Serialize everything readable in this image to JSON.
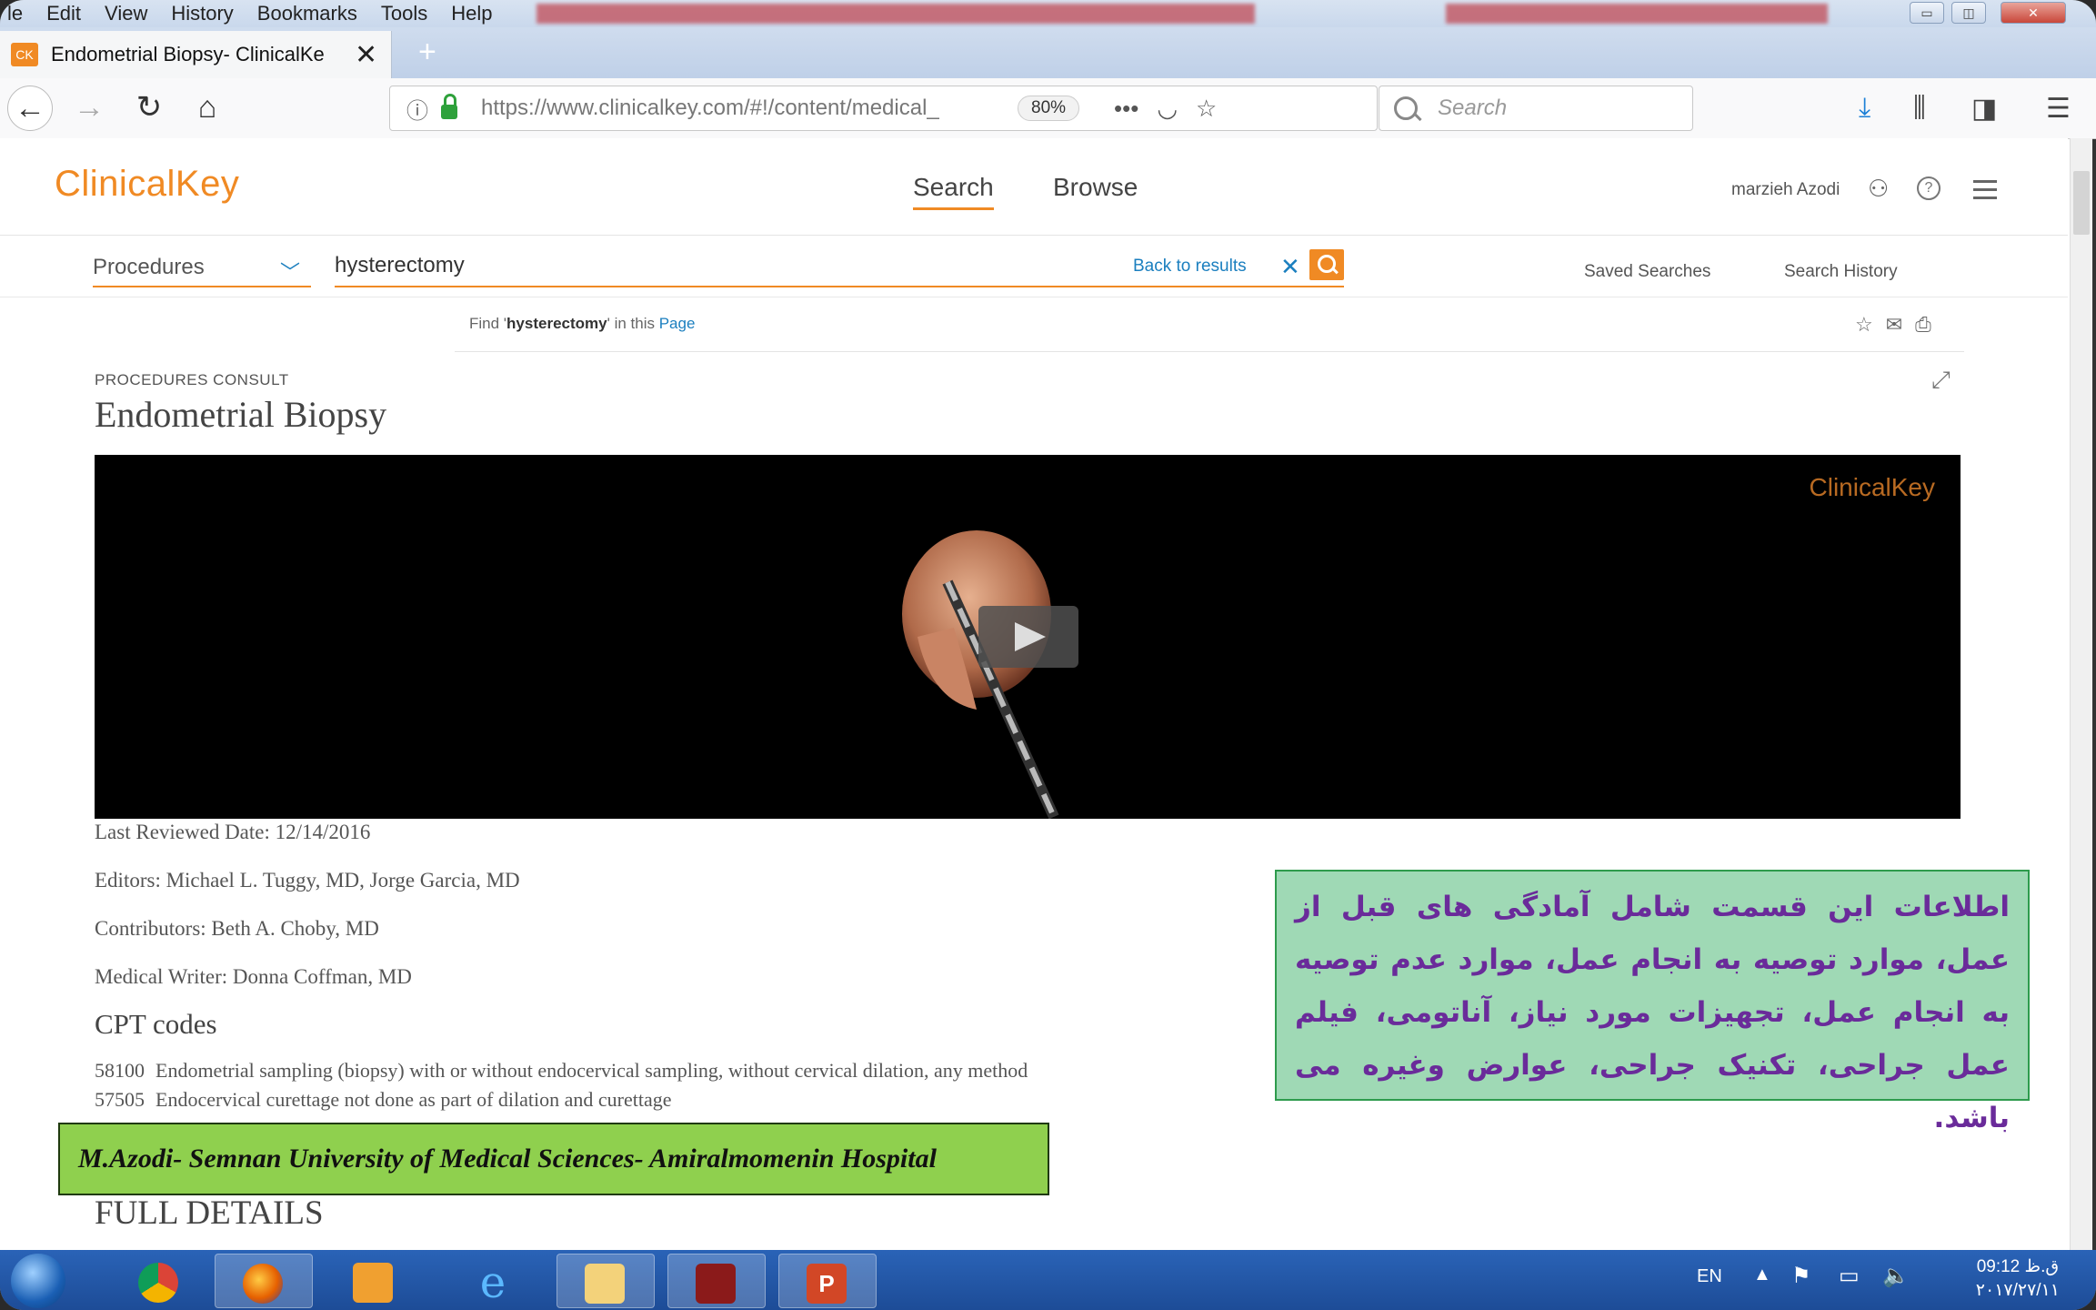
{
  "browser": {
    "menu": [
      "le",
      "Edit",
      "View",
      "History",
      "Bookmarks",
      "Tools",
      "Help"
    ],
    "tab": {
      "favicon": "CK",
      "title": "Endometrial Biopsy- ClinicalKe",
      "close": "✕"
    },
    "new_tab": "+",
    "url": "https://www.clinicalkey.com/#!/content/medical_",
    "zoom": "80%",
    "search_placeholder": "Search",
    "icons": [
      "back-icon",
      "forward-icon",
      "reload-icon",
      "home-icon",
      "info-icon",
      "lock-icon",
      "more-icon",
      "pocket-icon",
      "star-icon",
      "download-icon",
      "library-icon",
      "sidebar-icon",
      "menu-icon"
    ]
  },
  "clinicalkey": {
    "logo": "ClinicalKey",
    "nav": {
      "search": "Search",
      "browse": "Browse"
    },
    "user": "marzieh Azodi",
    "search": {
      "category": "Procedures",
      "query": "hysterectomy",
      "back_to_results": "Back to results",
      "saved_searches": "Saved Searches",
      "search_history": "Search History"
    },
    "find": {
      "prefix": "Find '",
      "term": "hysterectomy",
      "middle": "' in this ",
      "link": "Page"
    },
    "article": {
      "eyebrow": "PROCEDURES CONSULT",
      "title": "Endometrial Biopsy",
      "video_logo": "ClinicalKey",
      "reviewed": "Last Reviewed Date: 12/14/2016",
      "editors": "Editors: Michael L. Tuggy, MD, Jorge Garcia, MD",
      "contributors": "Contributors: Beth A. Choby, MD",
      "writer": "Medical Writer: Donna Coffman, MD",
      "cpt_heading": "CPT codes",
      "cpt": [
        {
          "code": "58100",
          "desc": "Endometrial sampling (biopsy) with or without endocervical sampling, without cervical dilation, any method"
        },
        {
          "code": "57505",
          "desc": "Endocervical curettage not done as part of dilation and curettage"
        }
      ],
      "full_details": "FULL DETAILS"
    }
  },
  "overlay": {
    "credit": "M.Azodi- Semnan University of  Medical Sciences- Amiralmomenin Hospital",
    "note": "اطلاعات این قسمت شامل آمادگی های قبل از عمل، موارد توصیه به انجام عمل، موارد عدم توصیه به انجام عمل، تجهیزات مورد نیاز، آناتومی، فیلم عمل جراحی، تکنیک جراحی، عوارض وغیره می باشد."
  },
  "taskbar": {
    "lang": "EN",
    "time": "09:12 ق.ظ",
    "date": "۲۰۱۷/۲۷/۱۱"
  },
  "colors": {
    "accent": "#f08a24",
    "link": "#1b7fbf",
    "note_text": "#6a2b9a",
    "note_bg": "#9fd9b5",
    "credit_bg": "#8fd04e"
  }
}
